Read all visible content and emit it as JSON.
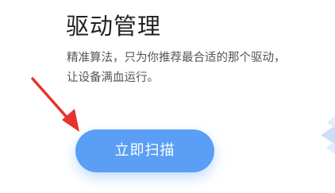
{
  "section": {
    "title": "驱动管理",
    "description_lines": [
      "精准算法，只为你推荐最合适的那个驱动，",
      "让设备满血运行。"
    ],
    "scan_button_label": "立即扫描"
  },
  "colors": {
    "accent": "#5a9ef6",
    "arrow": "#e8322d",
    "title": "#222222",
    "description": "#555555"
  },
  "icons": {
    "annotation": "red-arrow-icon",
    "decoration": "stacked-chevron-decoration"
  }
}
